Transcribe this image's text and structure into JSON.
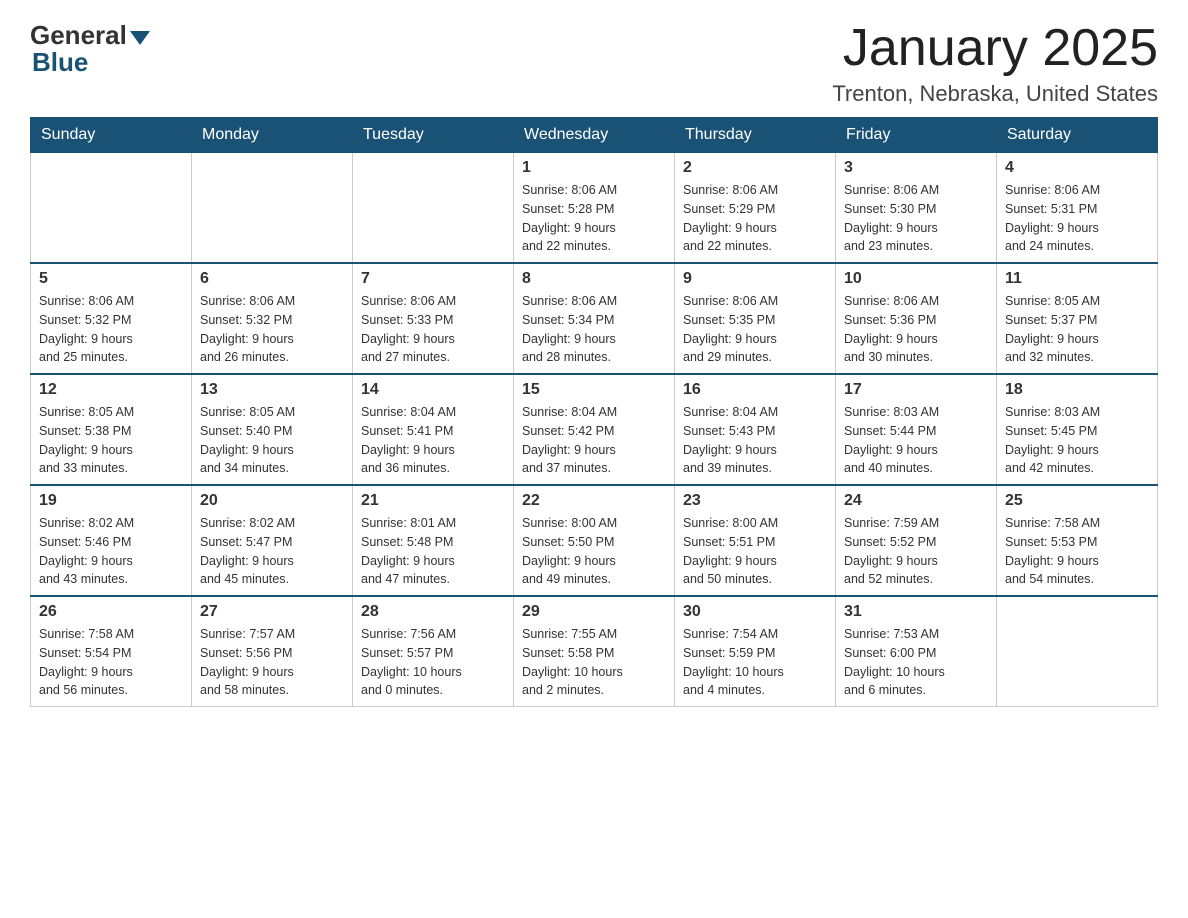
{
  "header": {
    "logo_general": "General",
    "logo_blue": "Blue",
    "month_title": "January 2025",
    "location": "Trenton, Nebraska, United States"
  },
  "days_of_week": [
    "Sunday",
    "Monday",
    "Tuesday",
    "Wednesday",
    "Thursday",
    "Friday",
    "Saturday"
  ],
  "weeks": [
    [
      {
        "day": "",
        "info": ""
      },
      {
        "day": "",
        "info": ""
      },
      {
        "day": "",
        "info": ""
      },
      {
        "day": "1",
        "info": "Sunrise: 8:06 AM\nSunset: 5:28 PM\nDaylight: 9 hours\nand 22 minutes."
      },
      {
        "day": "2",
        "info": "Sunrise: 8:06 AM\nSunset: 5:29 PM\nDaylight: 9 hours\nand 22 minutes."
      },
      {
        "day": "3",
        "info": "Sunrise: 8:06 AM\nSunset: 5:30 PM\nDaylight: 9 hours\nand 23 minutes."
      },
      {
        "day": "4",
        "info": "Sunrise: 8:06 AM\nSunset: 5:31 PM\nDaylight: 9 hours\nand 24 minutes."
      }
    ],
    [
      {
        "day": "5",
        "info": "Sunrise: 8:06 AM\nSunset: 5:32 PM\nDaylight: 9 hours\nand 25 minutes."
      },
      {
        "day": "6",
        "info": "Sunrise: 8:06 AM\nSunset: 5:32 PM\nDaylight: 9 hours\nand 26 minutes."
      },
      {
        "day": "7",
        "info": "Sunrise: 8:06 AM\nSunset: 5:33 PM\nDaylight: 9 hours\nand 27 minutes."
      },
      {
        "day": "8",
        "info": "Sunrise: 8:06 AM\nSunset: 5:34 PM\nDaylight: 9 hours\nand 28 minutes."
      },
      {
        "day": "9",
        "info": "Sunrise: 8:06 AM\nSunset: 5:35 PM\nDaylight: 9 hours\nand 29 minutes."
      },
      {
        "day": "10",
        "info": "Sunrise: 8:06 AM\nSunset: 5:36 PM\nDaylight: 9 hours\nand 30 minutes."
      },
      {
        "day": "11",
        "info": "Sunrise: 8:05 AM\nSunset: 5:37 PM\nDaylight: 9 hours\nand 32 minutes."
      }
    ],
    [
      {
        "day": "12",
        "info": "Sunrise: 8:05 AM\nSunset: 5:38 PM\nDaylight: 9 hours\nand 33 minutes."
      },
      {
        "day": "13",
        "info": "Sunrise: 8:05 AM\nSunset: 5:40 PM\nDaylight: 9 hours\nand 34 minutes."
      },
      {
        "day": "14",
        "info": "Sunrise: 8:04 AM\nSunset: 5:41 PM\nDaylight: 9 hours\nand 36 minutes."
      },
      {
        "day": "15",
        "info": "Sunrise: 8:04 AM\nSunset: 5:42 PM\nDaylight: 9 hours\nand 37 minutes."
      },
      {
        "day": "16",
        "info": "Sunrise: 8:04 AM\nSunset: 5:43 PM\nDaylight: 9 hours\nand 39 minutes."
      },
      {
        "day": "17",
        "info": "Sunrise: 8:03 AM\nSunset: 5:44 PM\nDaylight: 9 hours\nand 40 minutes."
      },
      {
        "day": "18",
        "info": "Sunrise: 8:03 AM\nSunset: 5:45 PM\nDaylight: 9 hours\nand 42 minutes."
      }
    ],
    [
      {
        "day": "19",
        "info": "Sunrise: 8:02 AM\nSunset: 5:46 PM\nDaylight: 9 hours\nand 43 minutes."
      },
      {
        "day": "20",
        "info": "Sunrise: 8:02 AM\nSunset: 5:47 PM\nDaylight: 9 hours\nand 45 minutes."
      },
      {
        "day": "21",
        "info": "Sunrise: 8:01 AM\nSunset: 5:48 PM\nDaylight: 9 hours\nand 47 minutes."
      },
      {
        "day": "22",
        "info": "Sunrise: 8:00 AM\nSunset: 5:50 PM\nDaylight: 9 hours\nand 49 minutes."
      },
      {
        "day": "23",
        "info": "Sunrise: 8:00 AM\nSunset: 5:51 PM\nDaylight: 9 hours\nand 50 minutes."
      },
      {
        "day": "24",
        "info": "Sunrise: 7:59 AM\nSunset: 5:52 PM\nDaylight: 9 hours\nand 52 minutes."
      },
      {
        "day": "25",
        "info": "Sunrise: 7:58 AM\nSunset: 5:53 PM\nDaylight: 9 hours\nand 54 minutes."
      }
    ],
    [
      {
        "day": "26",
        "info": "Sunrise: 7:58 AM\nSunset: 5:54 PM\nDaylight: 9 hours\nand 56 minutes."
      },
      {
        "day": "27",
        "info": "Sunrise: 7:57 AM\nSunset: 5:56 PM\nDaylight: 9 hours\nand 58 minutes."
      },
      {
        "day": "28",
        "info": "Sunrise: 7:56 AM\nSunset: 5:57 PM\nDaylight: 10 hours\nand 0 minutes."
      },
      {
        "day": "29",
        "info": "Sunrise: 7:55 AM\nSunset: 5:58 PM\nDaylight: 10 hours\nand 2 minutes."
      },
      {
        "day": "30",
        "info": "Sunrise: 7:54 AM\nSunset: 5:59 PM\nDaylight: 10 hours\nand 4 minutes."
      },
      {
        "day": "31",
        "info": "Sunrise: 7:53 AM\nSunset: 6:00 PM\nDaylight: 10 hours\nand 6 minutes."
      },
      {
        "day": "",
        "info": ""
      }
    ]
  ]
}
